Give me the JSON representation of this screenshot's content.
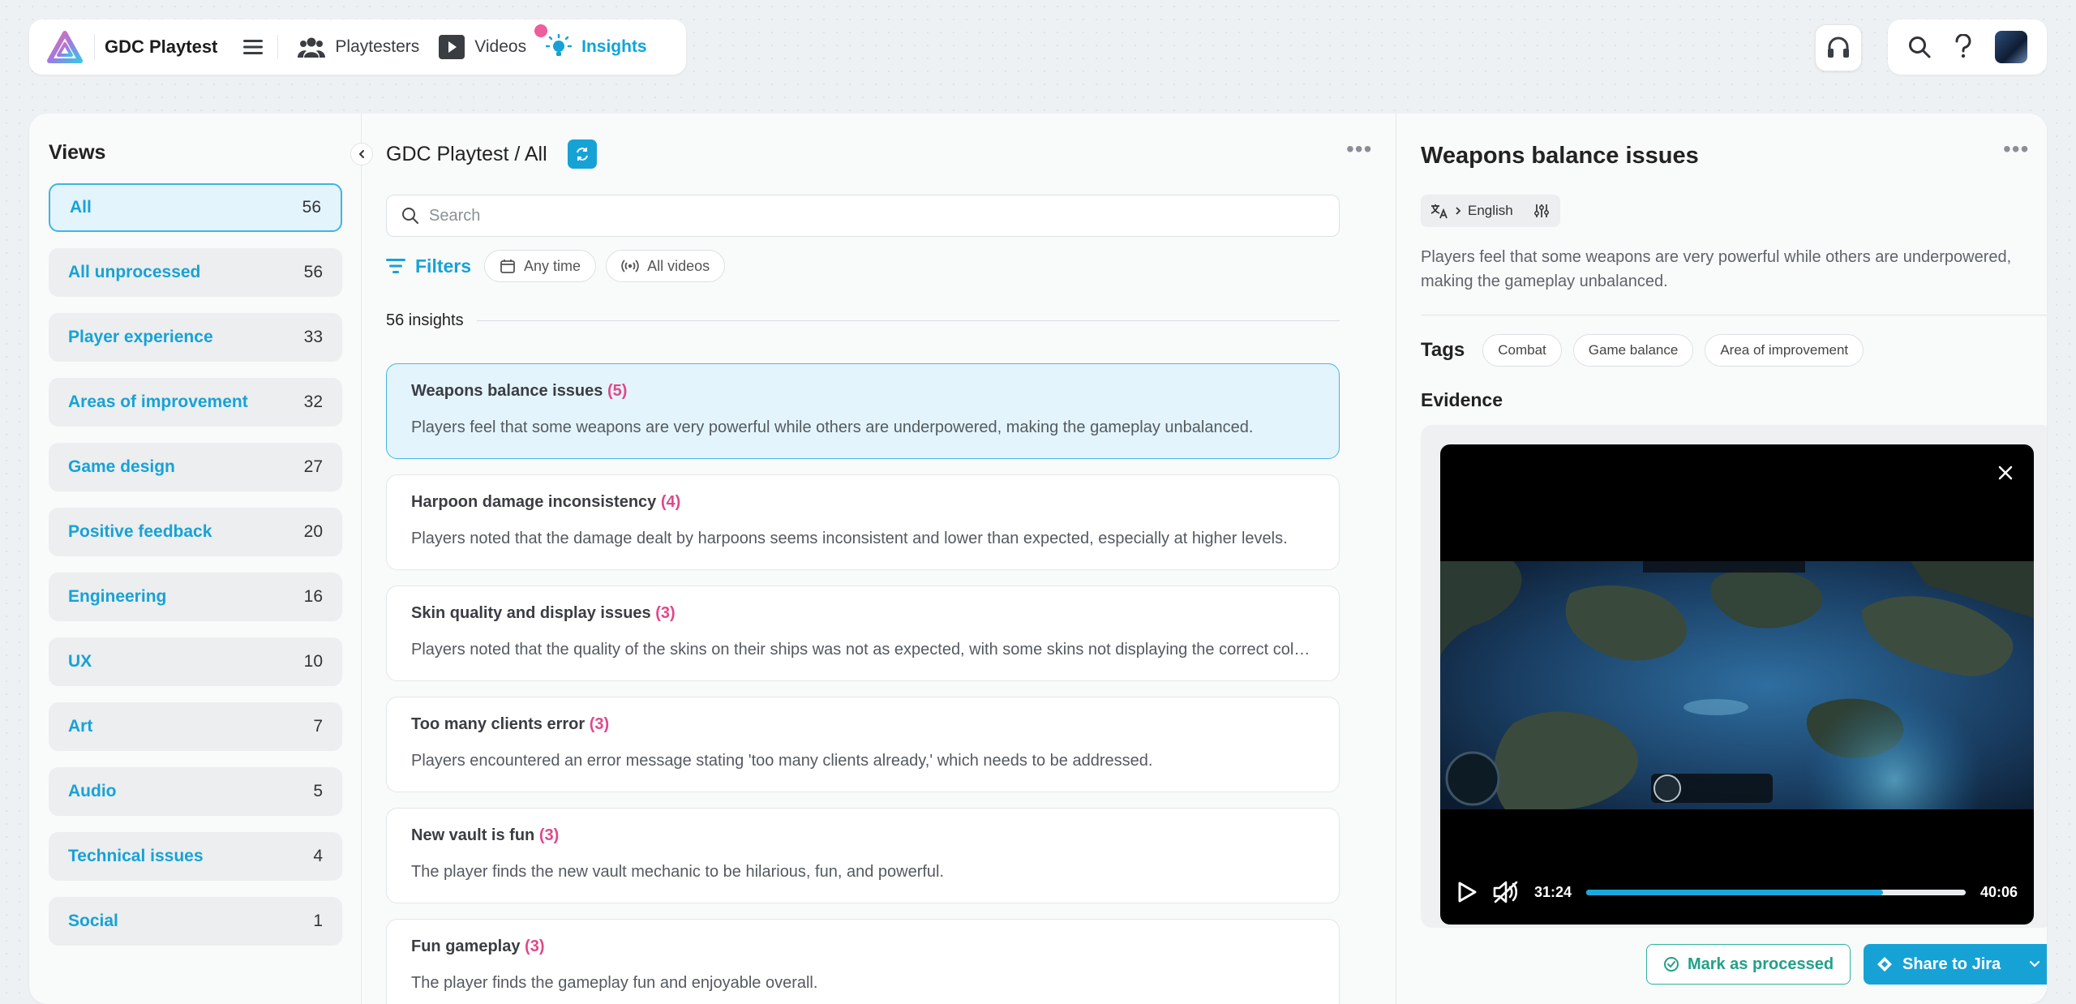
{
  "nav": {
    "brand": "GDC Playtest",
    "items": [
      {
        "label": "Playtesters",
        "icon": "users-icon"
      },
      {
        "label": "Videos",
        "icon": "video-icon"
      },
      {
        "label": "Insights",
        "icon": "lightbulb-icon"
      }
    ],
    "active": "Insights"
  },
  "sidebar": {
    "title": "Views",
    "items": [
      {
        "label": "All",
        "count": "56"
      },
      {
        "label": "All unprocessed",
        "count": "56"
      },
      {
        "label": "Player experience",
        "count": "33"
      },
      {
        "label": "Areas of improvement",
        "count": "32"
      },
      {
        "label": "Game design",
        "count": "27"
      },
      {
        "label": "Positive feedback",
        "count": "20"
      },
      {
        "label": "Engineering",
        "count": "16"
      },
      {
        "label": "UX",
        "count": "10"
      },
      {
        "label": "Art",
        "count": "7"
      },
      {
        "label": "Audio",
        "count": "5"
      },
      {
        "label": "Technical issues",
        "count": "4"
      },
      {
        "label": "Social",
        "count": "1"
      }
    ]
  },
  "middle": {
    "breadcrumb": "GDC Playtest / All",
    "search_placeholder": "Search",
    "filters_label": "Filters",
    "chips": [
      "Any time",
      "All videos"
    ],
    "insight_count": "56 insights",
    "insights": [
      {
        "title": "Weapons balance issues",
        "count": "(5)",
        "desc": "Players feel that some weapons are very powerful while others are underpowered, making the gameplay unbalanced."
      },
      {
        "title": "Harpoon damage inconsistency",
        "count": "(4)",
        "desc": "Players noted that the damage dealt by harpoons seems inconsistent and lower than expected, especially at higher levels."
      },
      {
        "title": "Skin quality and display issues",
        "count": "(3)",
        "desc": "Players noted that the quality of the skins on their ships was not as expected, with some skins not displaying the correct colors."
      },
      {
        "title": "Too many clients error",
        "count": "(3)",
        "desc": "Players encountered an error message stating 'too many clients already,' which needs to be addressed."
      },
      {
        "title": "New vault is fun",
        "count": "(3)",
        "desc": "The player finds the new vault mechanic to be hilarious, fun, and powerful."
      },
      {
        "title": "Fun gameplay",
        "count": "(3)",
        "desc": "The player finds the gameplay fun and enjoyable overall."
      }
    ]
  },
  "detail": {
    "title": "Weapons balance issues",
    "language": "English",
    "description": "Players feel that some weapons are very powerful while others are underpowered, making the gameplay unbalanced.",
    "tags_label": "Tags",
    "tags": [
      "Combat",
      "Game balance",
      "Area of improvement"
    ],
    "evidence_label": "Evidence",
    "video": {
      "current_time": "31:24",
      "duration": "40:06",
      "progress": 0.783
    },
    "mark_processed_label": "Mark as processed",
    "share_label": "Share to Jira"
  },
  "colors": {
    "accent": "#17a2d6",
    "badge": "#e0478a",
    "processed": "#2fb39c",
    "notification": "#ee5d9c"
  }
}
